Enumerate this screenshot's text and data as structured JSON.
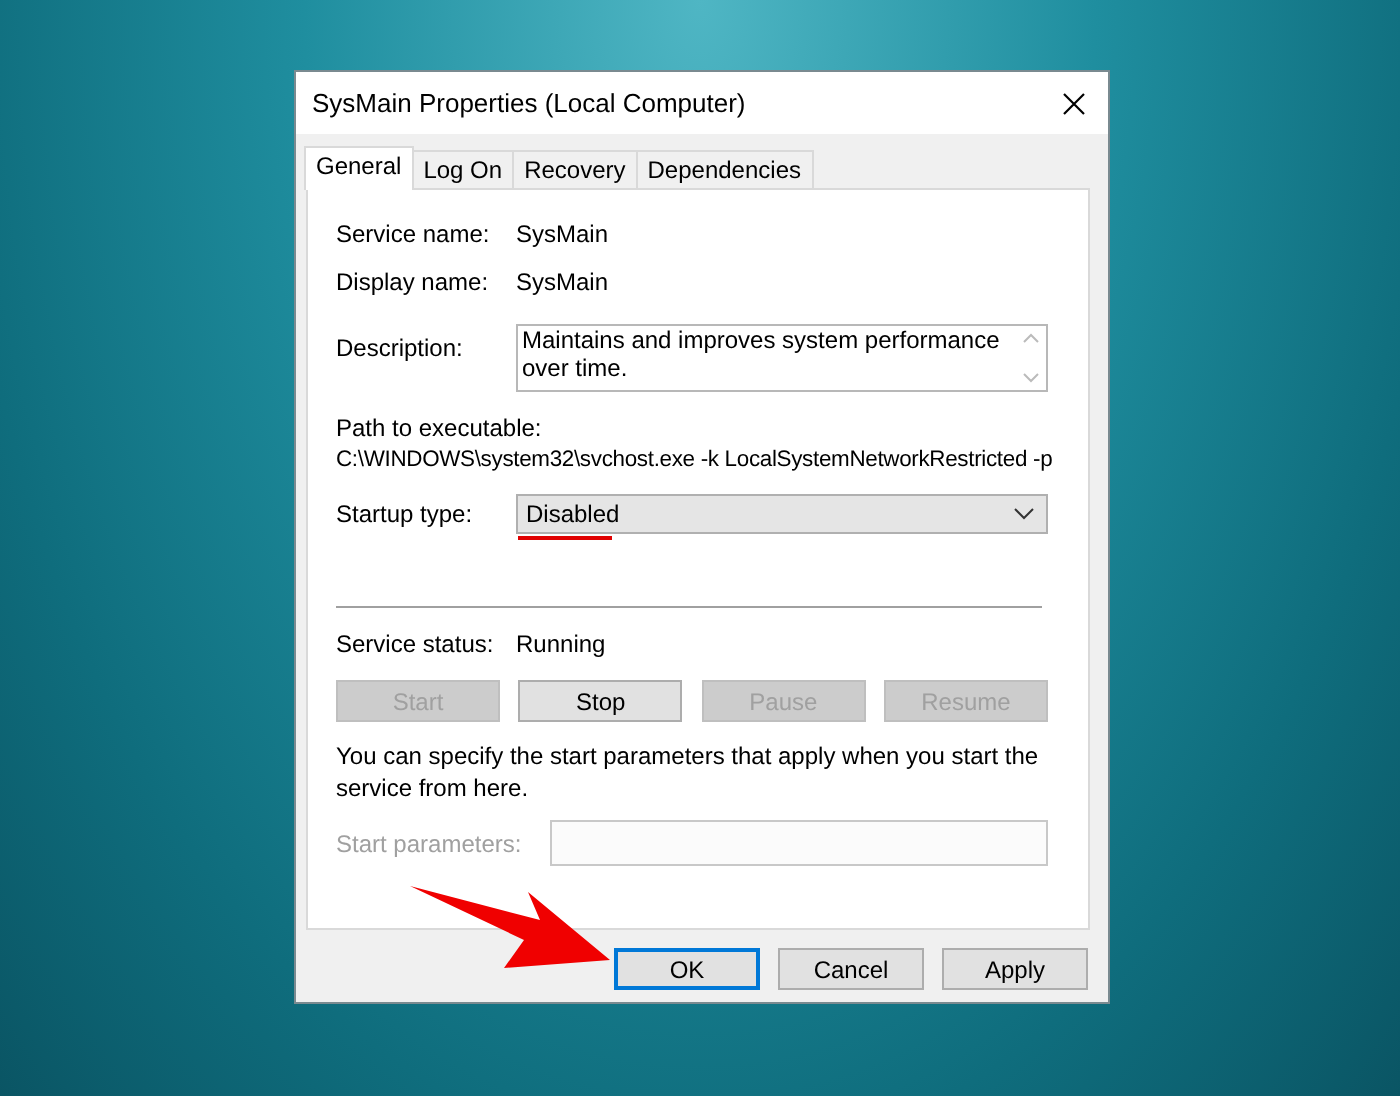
{
  "window": {
    "title": "SysMain Properties (Local Computer)"
  },
  "tabs": [
    {
      "label": "General",
      "selected": true
    },
    {
      "label": "Log On",
      "selected": false
    },
    {
      "label": "Recovery",
      "selected": false
    },
    {
      "label": "Dependencies",
      "selected": false
    }
  ],
  "general": {
    "service_name": {
      "label": "Service name:",
      "value": "SysMain"
    },
    "display_name": {
      "label": "Display name:",
      "value": "SysMain"
    },
    "description": {
      "label": "Description:",
      "value": "Maintains and improves system performance over time."
    },
    "path": {
      "label": "Path to executable:",
      "value": "C:\\WINDOWS\\system32\\svchost.exe -k LocalSystemNetworkRestricted -p"
    },
    "startup_type": {
      "label": "Startup type:",
      "value": "Disabled"
    },
    "service_status": {
      "label": "Service status:",
      "value": "Running"
    },
    "service_buttons": [
      {
        "label": "Start",
        "disabled": true
      },
      {
        "label": "Stop",
        "disabled": false
      },
      {
        "label": "Pause",
        "disabled": true
      },
      {
        "label": "Resume",
        "disabled": true
      }
    ],
    "note": "You can specify the start parameters that apply when you start the service from here.",
    "start_parameters": {
      "label": "Start parameters:",
      "disabled": true
    }
  },
  "buttons": [
    {
      "label": "OK",
      "focused": true
    },
    {
      "label": "Cancel",
      "focused": false
    },
    {
      "label": "Apply",
      "focused": false
    }
  ]
}
